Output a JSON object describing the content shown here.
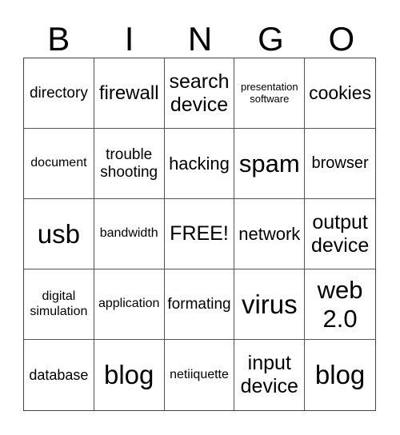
{
  "header": [
    "B",
    "I",
    "N",
    "G",
    "O"
  ],
  "cells": [
    {
      "text": "directory",
      "size": 19
    },
    {
      "text": "firewall",
      "size": 24
    },
    {
      "text": "search device",
      "size": 25
    },
    {
      "text": "presentation software",
      "size": 13
    },
    {
      "text": "cookies",
      "size": 23
    },
    {
      "text": "document",
      "size": 16
    },
    {
      "text": "trouble shooting",
      "size": 19
    },
    {
      "text": "hacking",
      "size": 22
    },
    {
      "text": "spam",
      "size": 31
    },
    {
      "text": "browser",
      "size": 20
    },
    {
      "text": "usb",
      "size": 33
    },
    {
      "text": "bandwidth",
      "size": 16
    },
    {
      "text": "FREE!",
      "size": 25
    },
    {
      "text": "network",
      "size": 22
    },
    {
      "text": "output device",
      "size": 25
    },
    {
      "text": "digital simulation",
      "size": 16
    },
    {
      "text": "application",
      "size": 16
    },
    {
      "text": "formating",
      "size": 19
    },
    {
      "text": "virus",
      "size": 33
    },
    {
      "text": "web 2.0",
      "size": 31
    },
    {
      "text": "database",
      "size": 18
    },
    {
      "text": "blog",
      "size": 33
    },
    {
      "text": "netiiquette",
      "size": 16
    },
    {
      "text": "input device",
      "size": 25
    },
    {
      "text": "blog",
      "size": 33
    }
  ]
}
